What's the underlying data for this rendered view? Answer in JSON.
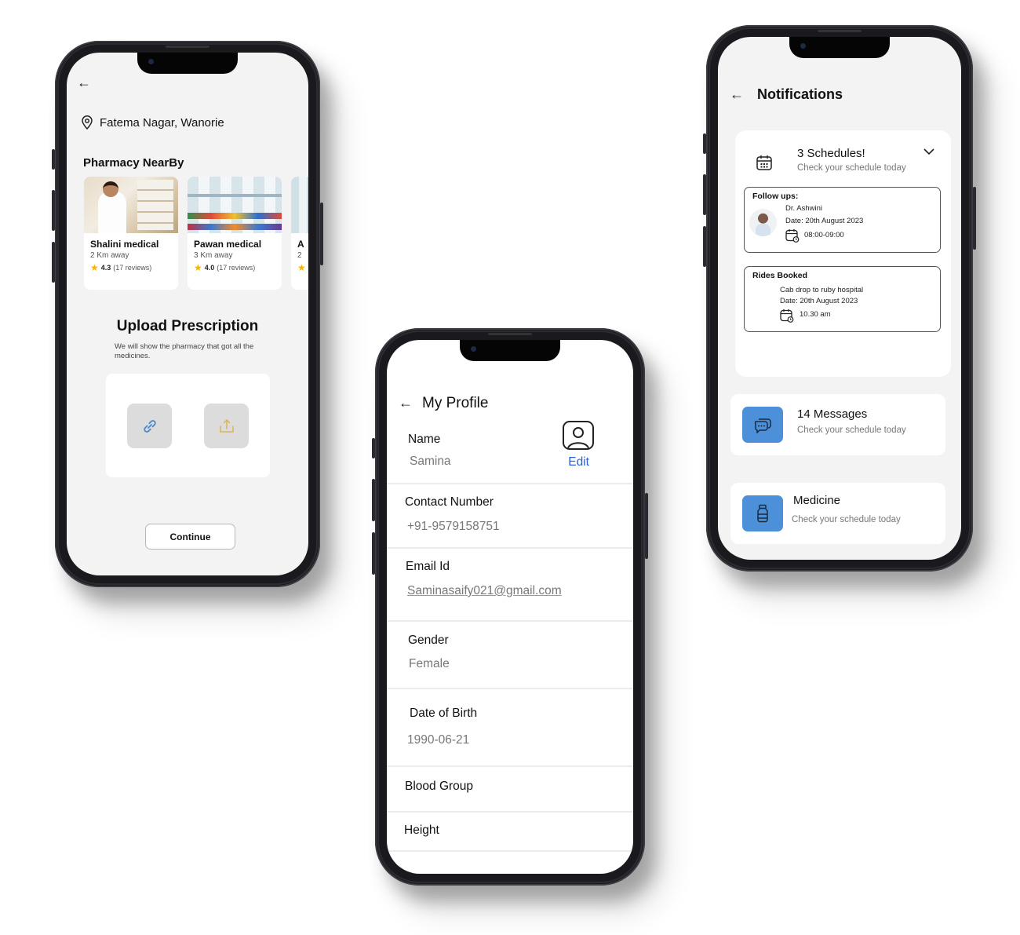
{
  "pharmacy_screen": {
    "location": "Fatema Nagar, Wanorie",
    "section_title": "Pharmacy NearBy",
    "pharmacies": [
      {
        "name": "Shalini medical",
        "distance": "2 Km away",
        "rating": "4.3",
        "reviews": "(17 reviews)"
      },
      {
        "name": "Pawan medical",
        "distance": "3 Km away",
        "rating": "4.0",
        "reviews": "(17 reviews)"
      },
      {
        "name": "A",
        "distance": "2",
        "rating": "",
        "reviews": ""
      }
    ],
    "upload_title": "Upload Prescription",
    "upload_subtitle": "We will show the pharmacy that got all the medicines.",
    "continue_label": "Continue",
    "icons": {
      "back": "←",
      "star": "★"
    }
  },
  "profile_screen": {
    "title": "My Profile",
    "edit_label": "Edit",
    "fields": [
      {
        "label": "Name",
        "value": "Samina"
      },
      {
        "label": "Contact Number",
        "value": "+91-9579158751"
      },
      {
        "label": "Email Id",
        "value": "Saminasaify021@gmail.com"
      },
      {
        "label": "Gender",
        "value": "Female"
      },
      {
        "label": "Date of Birth",
        "value": "1990-06-21"
      },
      {
        "label": "Blood Group",
        "value": ""
      },
      {
        "label": "Height",
        "value": ""
      }
    ]
  },
  "notifications_screen": {
    "title": "Notifications",
    "schedules": {
      "title": "3 Schedules!",
      "subtitle": "Check your schedule today",
      "follow_up": {
        "heading": "Follow ups:",
        "doctor": "Dr. Ashwini",
        "date": "Date: 20th August 2023",
        "time": "08:00-09:00"
      },
      "ride": {
        "heading": "Rides Booked",
        "description": "Cab drop to ruby hospital",
        "date": "Date: 20th August 2023",
        "time": "10.30 am"
      }
    },
    "messages": {
      "title": "14 Messages",
      "subtitle": "Check your schedule today"
    },
    "medicine": {
      "title": "Medicine",
      "subtitle": "Check your schedule today"
    }
  },
  "colors": {
    "accent_blue": "#4b90d9",
    "edit_link": "#2a60d6",
    "star": "#f6b400",
    "upload_icon_gold": "#d9b45a",
    "link_icon_blue": "#4a86c8"
  }
}
